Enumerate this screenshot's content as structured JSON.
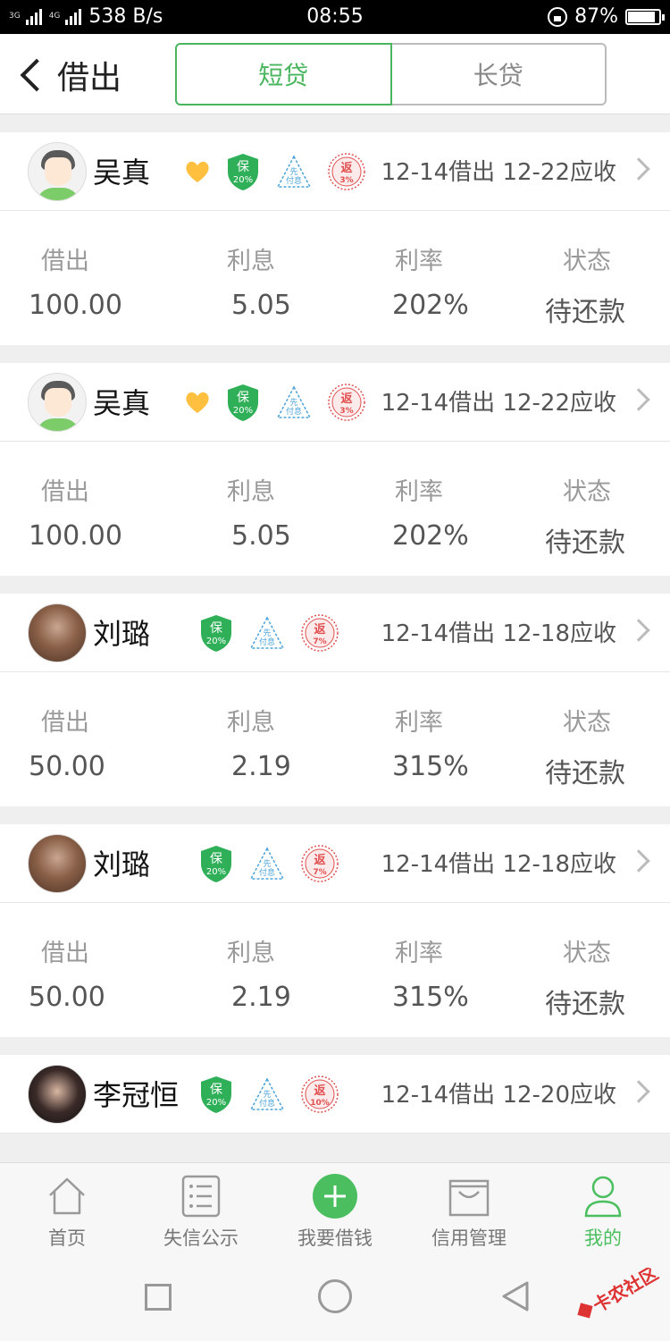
{
  "status_bar": {
    "net1": "3G",
    "net2": "4G",
    "speed": "538 B/s",
    "time": "08:55",
    "battery": "87%",
    "battery_level": 0.87
  },
  "header": {
    "title": "借出",
    "tabs": [
      {
        "label": "短贷",
        "active": true
      },
      {
        "label": "长贷",
        "active": false
      }
    ]
  },
  "columns": {
    "amount": "借出",
    "interest": "利息",
    "rate": "利率",
    "status": "状态"
  },
  "badge_labels": {
    "guarantee": "保",
    "prepay_line1": "先",
    "prepay_line2": "付息",
    "rebate": "返"
  },
  "loans": [
    {
      "name": "吴真",
      "avatar": "cartoon",
      "favorite": true,
      "guarantee_pct": "20%",
      "rebate_pct": "3%",
      "dates": "12-14借出 12-22应收",
      "amount": "100.00",
      "interest": "5.05",
      "rate": "202%",
      "status": "待还款"
    },
    {
      "name": "吴真",
      "avatar": "cartoon",
      "favorite": true,
      "guarantee_pct": "20%",
      "rebate_pct": "3%",
      "dates": "12-14借出 12-22应收",
      "amount": "100.00",
      "interest": "5.05",
      "rate": "202%",
      "status": "待还款"
    },
    {
      "name": "刘璐",
      "avatar": "photo1",
      "favorite": false,
      "guarantee_pct": "20%",
      "rebate_pct": "7%",
      "dates": "12-14借出 12-18应收",
      "amount": "50.00",
      "interest": "2.19",
      "rate": "315%",
      "status": "待还款"
    },
    {
      "name": "刘璐",
      "avatar": "photo1",
      "favorite": false,
      "guarantee_pct": "20%",
      "rebate_pct": "7%",
      "dates": "12-14借出 12-18应收",
      "amount": "50.00",
      "interest": "2.19",
      "rate": "315%",
      "status": "待还款"
    },
    {
      "name": "李冠恒",
      "avatar": "photo2",
      "favorite": false,
      "guarantee_pct": "20%",
      "rebate_pct": "10%",
      "dates": "12-14借出 12-20应收",
      "amount": "",
      "interest": "",
      "rate": "",
      "status": ""
    }
  ],
  "tab_bar": [
    {
      "label": "首页",
      "icon": "home-icon",
      "active": false
    },
    {
      "label": "失信公示",
      "icon": "list-icon",
      "active": false
    },
    {
      "label": "我要借钱",
      "icon": "plus-circle-icon",
      "active": false
    },
    {
      "label": "信用管理",
      "icon": "box-icon",
      "active": false
    },
    {
      "label": "我的",
      "icon": "person-icon",
      "active": true
    }
  ],
  "watermark_text": "卡农社区",
  "colors": {
    "accent": "#49b65f",
    "rebate": "#e05050",
    "prepay": "#4aa3d8",
    "heart": "#ffc040"
  }
}
